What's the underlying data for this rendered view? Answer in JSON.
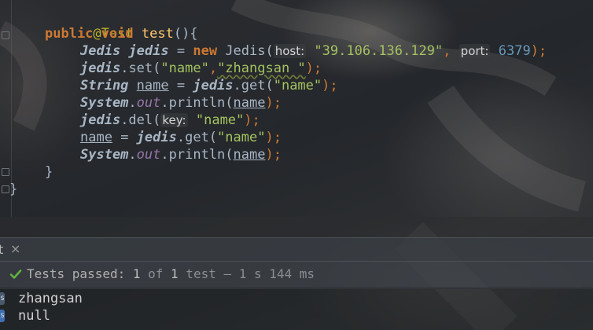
{
  "editor": {
    "lines": {
      "l1": {
        "annotation": "@Test"
      },
      "l2": {
        "kw_public": "public",
        "kw_void": "void",
        "method": "test",
        "paren": "(){"
      },
      "l3": {
        "type": "Jedis",
        "var": "jedis",
        "eq": " = ",
        "kw_new": "new",
        "ctor": " Jedis(",
        "hint_host": "host:",
        "host": "\"39.106.136.129\"",
        "comma": ",",
        "hint_port": "port:",
        "port": "6379",
        "end": ");"
      },
      "l4": {
        "var": "jedis",
        "dot": ".",
        "call": "set(",
        "arg1": "\"name\"",
        "comma": ",",
        "arg2": "\"zhangsan \"",
        "end": ");"
      },
      "l5": {
        "type": "String",
        "name": "name",
        "eq": " = ",
        "var": "jedis",
        "call": ".get(",
        "arg": "\"name\"",
        "end": ");"
      },
      "l6": {
        "type": "System",
        "dot": ".",
        "field": "out",
        "call": ".println(",
        "arg": "name",
        "end": ");"
      },
      "l7": {
        "var": "jedis",
        "call": ".del(",
        "hint_key": "key:",
        "arg": "\"name\"",
        "end": ");"
      },
      "l8": {
        "name": "name",
        "eq": " = ",
        "var": "jedis",
        "call": ".get(",
        "arg": "\"name\"",
        "end": ");"
      },
      "l9": {
        "type": "System",
        "dot": ".",
        "field": "out",
        "call": ".println(",
        "arg": "name",
        "end": ");"
      },
      "l10": {
        "brace": "}"
      },
      "l11": {
        "brace": "}"
      }
    }
  },
  "run_panel": {
    "tab": {
      "label": "t",
      "close": "×"
    },
    "status": {
      "prefix": "Tests passed: ",
      "passed": "1",
      "of": " of ",
      "total": "1",
      "suffix": " test – 1 s 144 ms"
    },
    "output": [
      "zhangsan",
      "null"
    ],
    "side_buttons": [
      "s",
      "s"
    ]
  },
  "colors": {
    "pass_check": "#5fb43e"
  },
  "icons": {
    "check": "check-icon",
    "close": "close-icon",
    "fold": "fold-marker-icon"
  }
}
